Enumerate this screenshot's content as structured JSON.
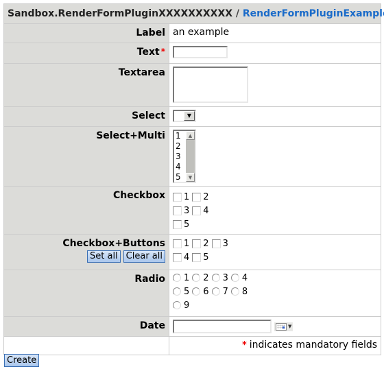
{
  "header": {
    "web": "Sandbox.RenderFormPluginXXXXXXXXXX",
    "separator": "/",
    "topic": "RenderFormPluginExampleForm"
  },
  "fields": {
    "label": {
      "label": "Label",
      "value": "an example"
    },
    "text": {
      "label": "Text",
      "required_mark": "*",
      "value": ""
    },
    "textarea": {
      "label": "Textarea",
      "value": ""
    },
    "select": {
      "label": "Select",
      "value": ""
    },
    "select_multi": {
      "label": "Select+Multi",
      "options": [
        "1",
        "2",
        "3",
        "4",
        "5"
      ]
    },
    "checkbox": {
      "label": "Checkbox",
      "options": [
        "1",
        "2",
        "3",
        "4",
        "5"
      ]
    },
    "checkbox_buttons": {
      "label": "Checkbox+Buttons",
      "options": [
        "1",
        "2",
        "3",
        "4",
        "5"
      ],
      "set_all_label": "Set all",
      "clear_all_label": "Clear all"
    },
    "radio": {
      "label": "Radio",
      "options": [
        "1",
        "2",
        "3",
        "4",
        "5",
        "6",
        "7",
        "8",
        "9"
      ]
    },
    "date": {
      "label": "Date",
      "value": ""
    }
  },
  "footer": {
    "required_mark": "*",
    "note": "indicates mandatory fields"
  },
  "actions": {
    "create_label": "Create"
  },
  "colors": {
    "label_bg": "#dcdcd9",
    "link": "#1a6bc9",
    "required": "#ee0000",
    "button_border": "#3a6fb4"
  }
}
